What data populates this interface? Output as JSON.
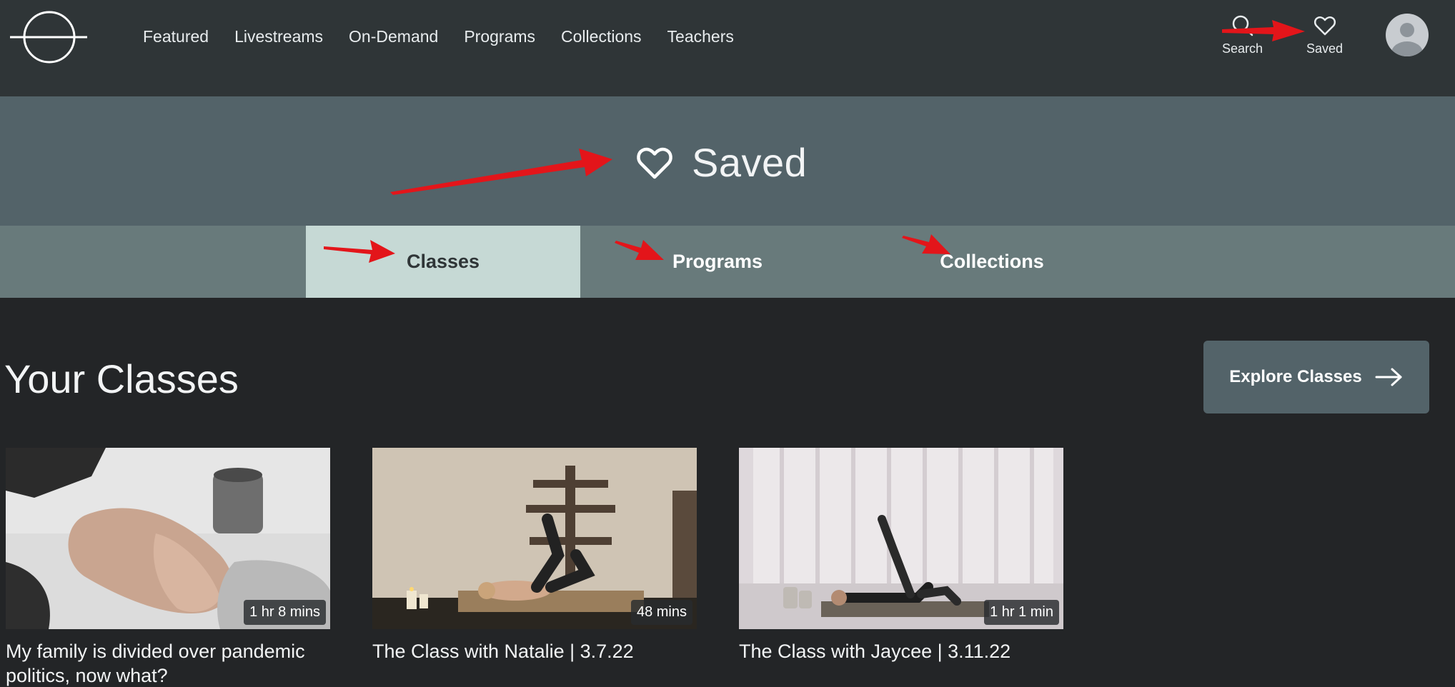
{
  "nav": {
    "links": [
      "Featured",
      "Livestreams",
      "On-Demand",
      "Programs",
      "Collections",
      "Teachers"
    ],
    "search_label": "Search",
    "saved_label": "Saved"
  },
  "hero": {
    "title": "Saved"
  },
  "tabs": [
    {
      "label": "Classes",
      "active": true
    },
    {
      "label": "Programs",
      "active": false
    },
    {
      "label": "Collections",
      "active": false
    }
  ],
  "section": {
    "title": "Your Classes",
    "explore_label": "Explore Classes"
  },
  "classes": [
    {
      "title": "My family is divided over pandemic politics, now what?",
      "duration": "1 hr 8 mins"
    },
    {
      "title": "The Class with Natalie | 3.7.22",
      "duration": "48 mins"
    },
    {
      "title": "The Class with Jaycee | 3.11.22",
      "duration": "1 hr 1 min"
    }
  ],
  "colors": {
    "nav_bg": "#2f3537",
    "hero_bg": "#536369",
    "tabs_bg": "#687a7b",
    "active_tab_bg": "#c6d9d5",
    "page_bg": "#232527",
    "annotation_arrow": "#e3151a"
  }
}
